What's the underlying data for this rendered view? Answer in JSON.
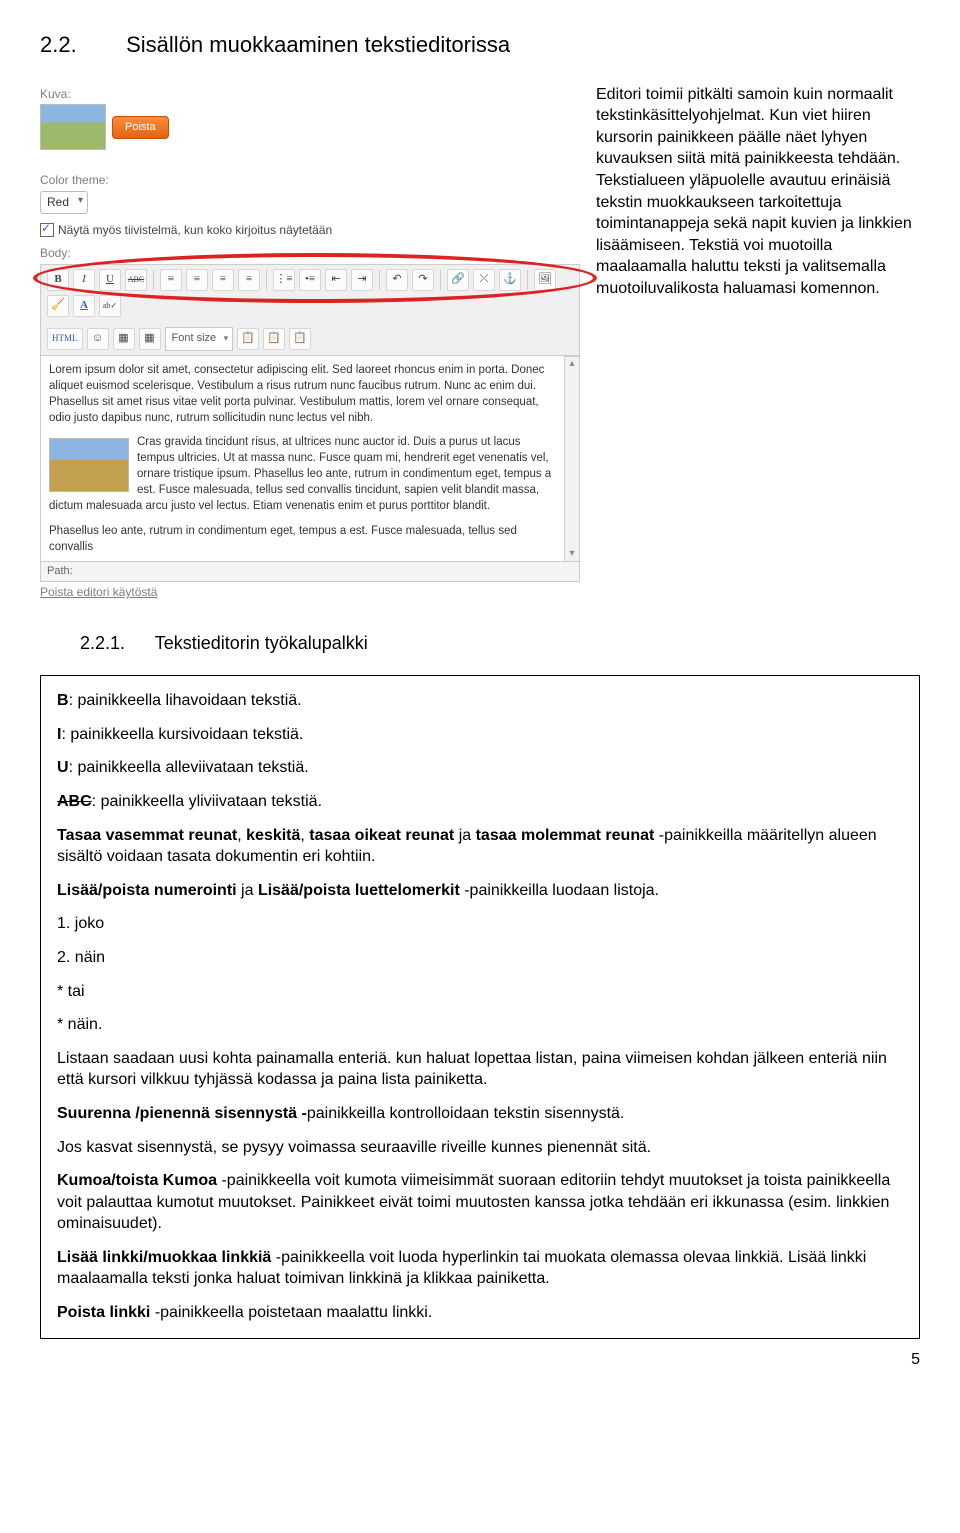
{
  "heading": {
    "num": "2.2.",
    "title": "Sisällön muokkaaminen tekstieditorissa"
  },
  "subheading": {
    "num": "2.2.1.",
    "title": "Tekstieditorin työkalupalkki"
  },
  "shot": {
    "kuva_label": "Kuva:",
    "poista": "Poista",
    "color_label": "Color theme:",
    "color_value": "Red",
    "checkbox": "Näytä myös tiivistelmä, kun koko kirjoitus näytetään",
    "body_label": "Body:",
    "toolbar": {
      "bold": "B",
      "italic": "I",
      "under": "U",
      "strike": "ABC",
      "html": "HTML",
      "fontsize": "Font size"
    },
    "lorem1": "Lorem ipsum dolor sit amet, consectetur adipiscing elit. Sed laoreet rhoncus enim in porta. Donec aliquet euismod scelerisque. Vestibulum a risus rutrum nunc faucibus rutrum. Nunc ac enim dui. Phasellus sit amet risus vitae velit porta pulvinar. Vestibulum mattis, lorem vel ornare consequat, odio justo dapibus nunc, rutrum sollicitudin nunc lectus vel nibh.",
    "lorem2": "Cras gravida tincidunt risus, at ultrices nunc auctor id. Duis a purus ut lacus tempus ultricies. Ut at massa nunc. Fusce quam mi, hendrerit eget venenatis vel, ornare tristique ipsum. Phasellus leo ante, rutrum in condimentum eget, tempus a est. Fusce malesuada, tellus sed convallis tincidunt, sapien velit blandit massa, dictum malesuada arcu justo vel lectus. Etiam venenatis enim et purus porttitor blandit.",
    "lorem3": "Phasellus leo ante, rutrum in condimentum eget, tempus a est. Fusce malesuada, tellus sed convallis",
    "path": "Path:",
    "disable": "Poista editori käytöstä"
  },
  "side_desc": "Editori toimii pitkälti samoin kuin normaalit tekstinkäsittelyohjelmat. Kun viet hiiren kursorin painikkeen päälle näet lyhyen kuvauksen siitä mitä painikkeesta tehdään. Tekstialueen yläpuolelle avautuu erinäisiä tekstin muokkaukseen tarkoitettuja toimintanappeja sekä napit kuvien ja linkkien lisäämiseen. Tekstiä voi muotoilla maalaamalla haluttu teksti ja valitsemalla muotoiluvalikosta haluamasi komennon.",
  "box": {
    "b": "B",
    "b_txt": ": painikkeella lihavoidaan tekstiä.",
    "i": "I",
    "i_txt": ": painikkeella kursivoidaan tekstiä.",
    "u": "U",
    "u_txt": ": painikkeella alleviivataan tekstiä.",
    "abc": "ABC",
    "abc_txt": ": painikkeella yliviivataan tekstiä.",
    "tasaa_b1": "Tasaa vasemmat reunat",
    "tasaa_b2": "keskitä",
    "tasaa_b3": "tasaa oikeat reunat",
    "tasaa_b4": "tasaa molemmat reunat",
    "tasaa_rest": " -painikkeilla määritellyn alueen sisältö voidaan tasata dokumentin eri kohtiin.",
    "lista_b1": "Lisää/poista numerointi",
    "lista_b2": "Lisää/poista luettelomerkit",
    "lista_rest": " -painikkeilla luodaan listoja.",
    "l1": "1. joko",
    "l2": "2. näin",
    "l3": "* tai",
    "l4": "* näin.",
    "lista_desc": "Listaan saadaan uusi kohta painamalla enteriä. kun haluat lopettaa listan, paina viimeisen kohdan jälkeen enteriä niin että kursori vilkkuu tyhjässä kodassa ja paina lista painiketta.",
    "indent_b": "Suurenna /pienennä sisennystä -",
    "indent_rest": "painikkeilla kontrolloidaan tekstin sisennystä.",
    "indent2": "Jos kasvat sisennystä, se pysyy voimassa seuraaville riveille kunnes pienennät sitä.",
    "undo_b": "Kumoa/toista Kumoa ",
    "undo_rest": "-painikkeella voit kumota viimeisimmät suoraan editoriin tehdyt muutokset ja toista painikkeella voit palauttaa kumotut muutokset. Painikkeet eivät toimi muutosten kanssa jotka tehdään eri ikkunassa (esim. linkkien ominaisuudet).",
    "link_b": "Lisää linkki/muokkaa linkkiä ",
    "link_rest": "-painikkeella voit luoda hyperlinkin tai muokata olemassa olevaa linkkiä. Lisää linkki maalaamalla teksti jonka haluat toimivan linkkinä ja klikkaa painiketta.",
    "unlink_b": "Poista linkki ",
    "unlink_rest": "-painikkeella poistetaan maalattu linkki."
  },
  "page_num": "5"
}
